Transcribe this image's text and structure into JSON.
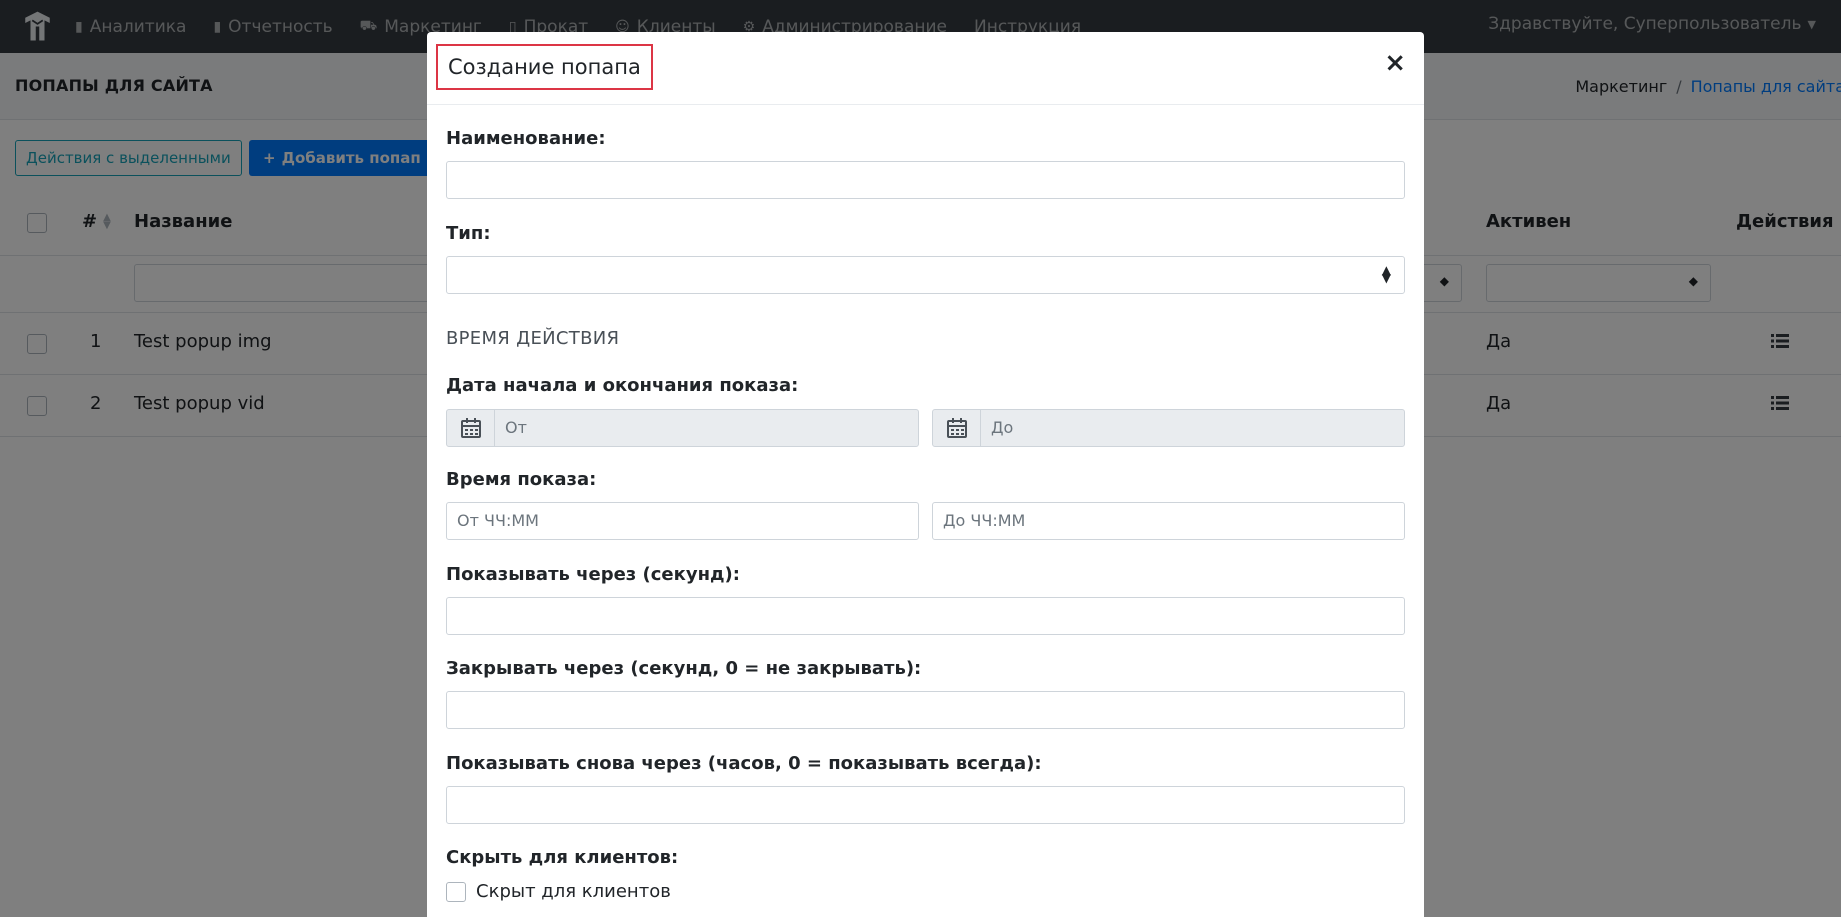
{
  "navbar": {
    "items": [
      {
        "icon": "bar-chart-icon",
        "label": "Аналитика"
      },
      {
        "icon": "bar-chart-icon",
        "label": "Отчетность"
      },
      {
        "icon": "cart-icon",
        "label": "Маркетинг"
      },
      {
        "icon": "book-icon",
        "label": "Прокат"
      },
      {
        "icon": "user-icon",
        "label": "Клиенты"
      },
      {
        "icon": "cogs-icon",
        "label": "Администрирование"
      },
      {
        "icon": "",
        "label": "Инструкция"
      }
    ],
    "greeting": "Здравствуйте, Суперпользователь"
  },
  "page": {
    "title": "ПОПАПЫ ДЛЯ САЙТА",
    "breadcrumb": {
      "parent": "Маркетинг",
      "separator": "/",
      "current": "Попапы для сайта"
    }
  },
  "toolbar": {
    "bulk_actions_label": "Действия с выделенными",
    "add_label": "Добавить попап"
  },
  "table": {
    "headers": {
      "number": "#",
      "name": "Название",
      "active": "Активен",
      "actions": "Действия"
    },
    "rows": [
      {
        "number": "1",
        "name": "Test popup img",
        "active": "Да"
      },
      {
        "number": "2",
        "name": "Test popup vid",
        "active": "Да"
      }
    ]
  },
  "modal": {
    "title": "Создание попапа",
    "close": "×",
    "name_label": "Наименование:",
    "name_value": "",
    "type_label": "Тип:",
    "type_value": "",
    "section_validity": "ВРЕМЯ ДЕЙСТВИЯ",
    "dates_label": "Дата начала и окончания показа:",
    "date_from_placeholder": "От",
    "date_to_placeholder": "До",
    "show_time_label": "Время показа:",
    "time_from_placeholder": "От ЧЧ:ММ",
    "time_to_placeholder": "До ЧЧ:ММ",
    "show_after_label": "Показывать через (секунд):",
    "close_after_label": "Закрывать через (секунд, 0 = не закрывать):",
    "show_again_label": "Показывать снова через (часов, 0 = показывать всегда):",
    "hide_for_clients_label": "Скрыть для клиентов:",
    "hidden_for_clients_checkbox": "Скрыт для клиентов"
  },
  "colors": {
    "navbar_bg": "#343a40",
    "primary": "#007bff",
    "info": "#17a2b8",
    "highlight": "#dc3545"
  }
}
